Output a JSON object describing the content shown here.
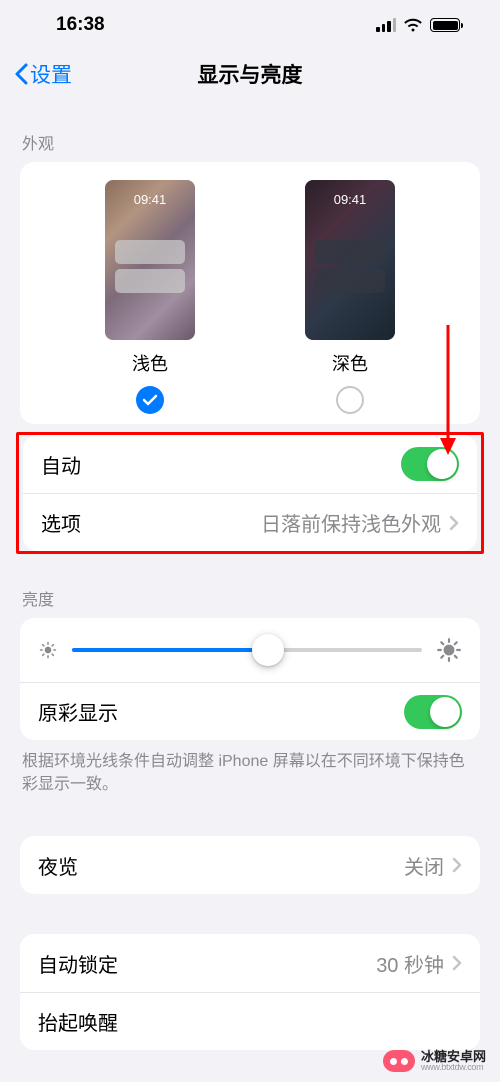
{
  "status": {
    "time": "16:38"
  },
  "nav": {
    "back": "设置",
    "title": "显示与亮度"
  },
  "appearance": {
    "section_label": "外观",
    "preview_time": "09:41",
    "light_label": "浅色",
    "dark_label": "深色",
    "auto_label": "自动",
    "options_label": "选项",
    "options_value": "日落前保持浅色外观"
  },
  "brightness": {
    "section_label": "亮度",
    "truetone_label": "原彩显示",
    "truetone_footer": "根据环境光线条件自动调整 iPhone 屏幕以在不同环境下保持色彩显示一致。"
  },
  "nightshift": {
    "label": "夜览",
    "value": "关闭"
  },
  "autolock": {
    "label": "自动锁定",
    "value": "30 秒钟"
  },
  "raise": {
    "label": "抬起唤醒"
  },
  "watermark": {
    "cn": "冰糖安卓网",
    "url": "www.btxtdw.com"
  }
}
